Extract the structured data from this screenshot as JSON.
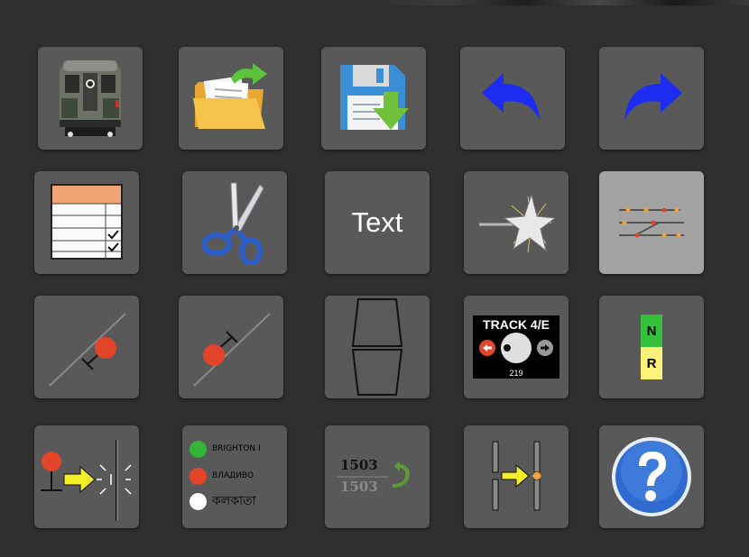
{
  "toolbar": {
    "text_tool_label": "Text",
    "track_panel": {
      "title": "TRACK 4/E",
      "number": "219"
    },
    "lever": {
      "normal": "N",
      "reverse": "R"
    },
    "station_labels": [
      "BRIGHTON I",
      "ВЛАДИВО",
      "কলকাতা"
    ],
    "number_swap": {
      "top": "1503",
      "bottom": "1503"
    }
  },
  "colors": {
    "background": "#2f2f2f",
    "button": "#595959",
    "button_active": "#a3a3a3",
    "arrow_blue": "#1d2cf0",
    "signal_red": "#e2452a",
    "highlight_yellow": "#f4ee2a"
  },
  "icons": [
    "subway-car-icon",
    "open-folder-icon",
    "save-disk-icon",
    "undo-arrow-icon",
    "redo-arrow-icon",
    "table-checklist-icon",
    "scissors-icon",
    "text-tool",
    "star-burst-icon",
    "track-layout-icon",
    "signal-left-icon",
    "signal-right-icon",
    "platform-shape-icon",
    "track-panel-icon",
    "lever-nr-icon",
    "signal-move-icon",
    "station-names-icon",
    "number-swap-icon",
    "track-insert-icon",
    "help-icon"
  ]
}
